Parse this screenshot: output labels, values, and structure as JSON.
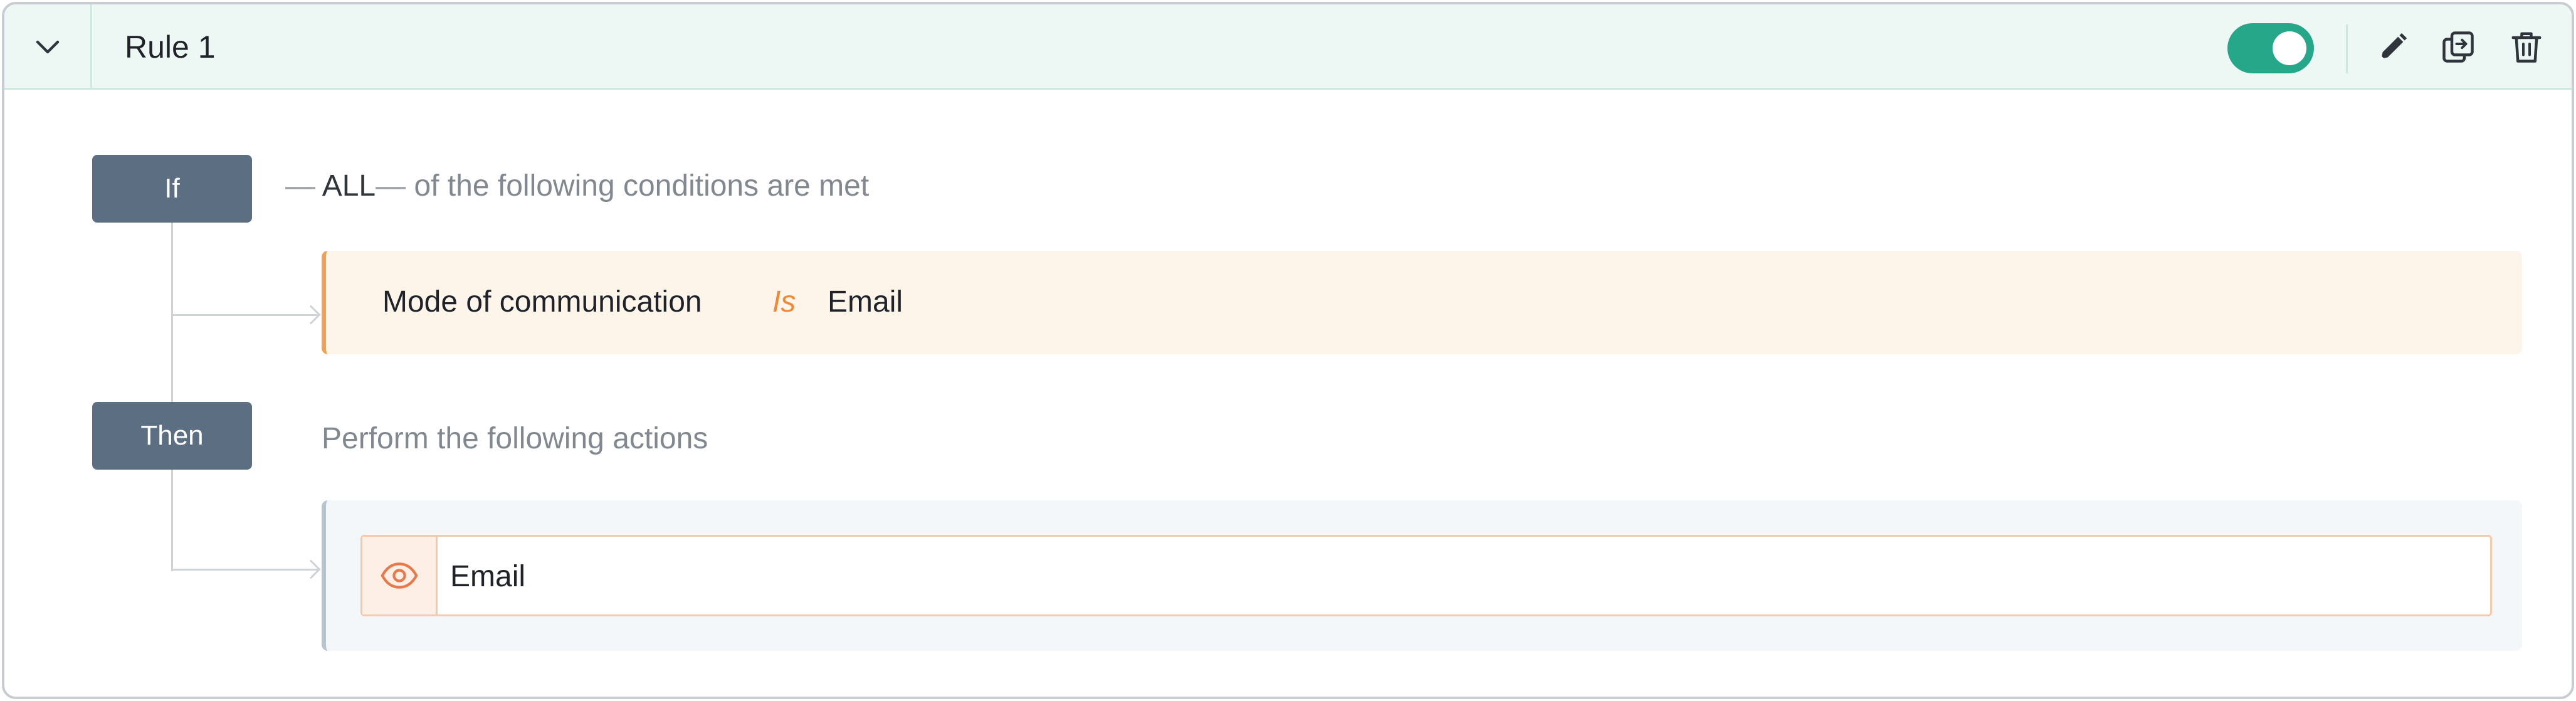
{
  "rule": {
    "title": "Rule 1",
    "enabled": true
  },
  "icons": {
    "collapse": "chevron-down-icon",
    "edit": "pencil-icon",
    "duplicate": "copy-icon",
    "delete": "trash-icon",
    "action": "eye-icon"
  },
  "if_block": {
    "tag_label": "If",
    "dash_left": "—",
    "match_mode": "ALL",
    "dash_right": "—",
    "suffix": "of the following conditions are met",
    "condition": {
      "field": "Mode of communication",
      "operator": "Is",
      "value": "Email"
    }
  },
  "then_block": {
    "tag_label": "Then",
    "description": "Perform the following actions",
    "action": {
      "label": "Email"
    }
  },
  "colors": {
    "header_bg": "#edf7f3",
    "toggle_on": "#26a789",
    "tag_bg": "#5c6f82",
    "condition_bg": "#fdf4ea",
    "condition_accent": "#f0a252",
    "operator": "#ee8a37",
    "action_bg": "#f4f7fa",
    "action_border": "#f6c9ab",
    "action_icon": "#e8794a"
  }
}
